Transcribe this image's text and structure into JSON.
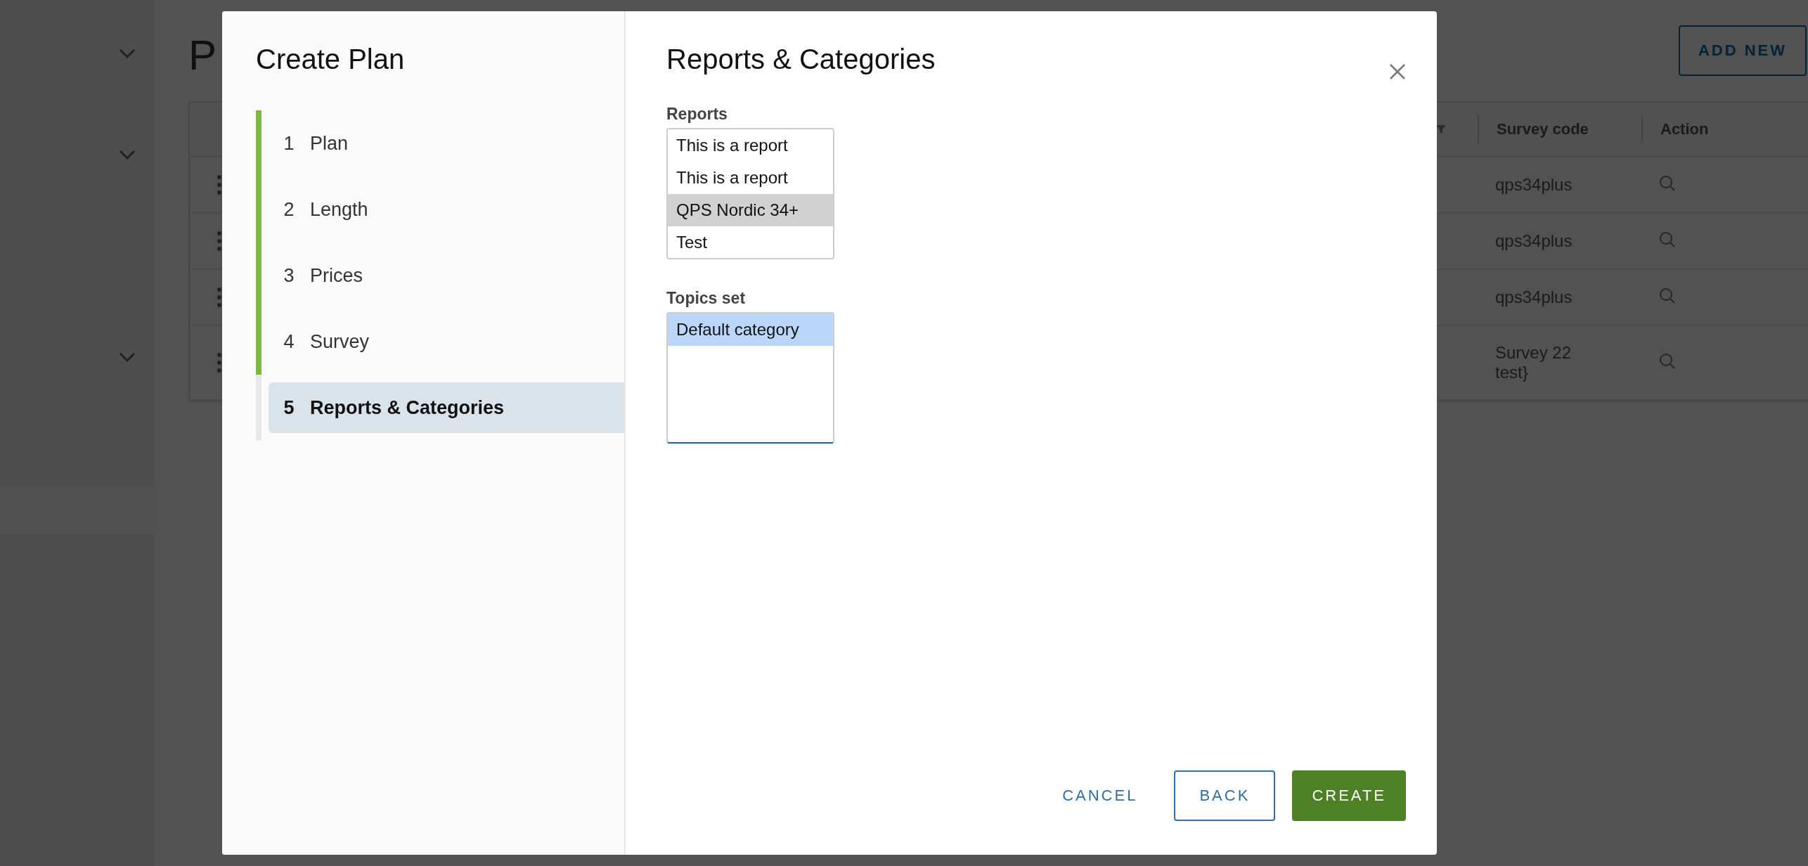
{
  "background_page": {
    "title": "P",
    "add_button": "ADD NEW",
    "table": {
      "columns": [
        "Survey code",
        "Action"
      ],
      "rows": [
        {
          "survey_code": "qps34plus"
        },
        {
          "survey_code": "qps34plus"
        },
        {
          "survey_code": "qps34plus"
        },
        {
          "survey_code": "Survey 22 test}"
        }
      ]
    }
  },
  "dialog": {
    "title": "Create Plan",
    "steps": [
      {
        "number": "1",
        "label": "Plan",
        "completed": true,
        "selected": false
      },
      {
        "number": "2",
        "label": "Length",
        "completed": true,
        "selected": false
      },
      {
        "number": "3",
        "label": "Prices",
        "completed": true,
        "selected": false
      },
      {
        "number": "4",
        "label": "Survey",
        "completed": true,
        "selected": false
      },
      {
        "number": "5",
        "label": "Reports & Categories",
        "completed": false,
        "selected": true
      }
    ],
    "panel_title": "Reports & Categories",
    "fields": [
      {
        "label": "Reports",
        "focused": false,
        "options": [
          {
            "text": "This is a report",
            "selected": false
          },
          {
            "text": "This is a report",
            "selected": false
          },
          {
            "text": "QPS Nordic 34+",
            "selected": true
          },
          {
            "text": "Test",
            "selected": false
          }
        ]
      },
      {
        "label": "Topics set",
        "focused": true,
        "options": [
          {
            "text": "Default category",
            "selected": true
          }
        ]
      }
    ],
    "buttons": [
      {
        "label": "CANCEL",
        "kind": "link"
      },
      {
        "label": "BACK",
        "kind": "outline"
      },
      {
        "label": "CREATE",
        "kind": "primary"
      }
    ]
  }
}
